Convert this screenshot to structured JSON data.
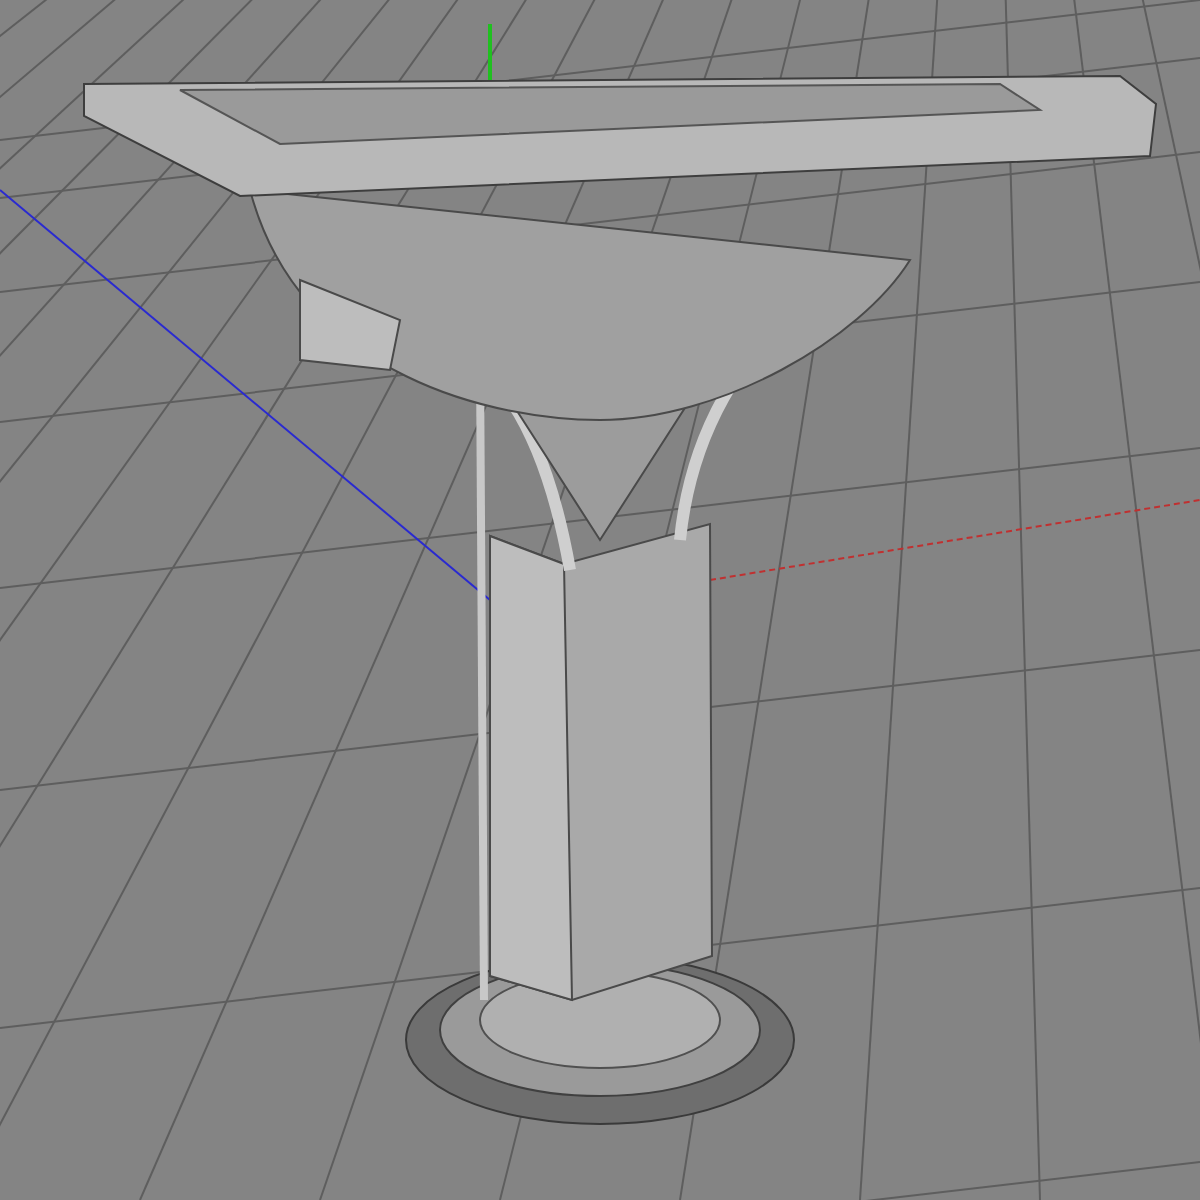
{
  "viewport": {
    "grid": true,
    "axes": true
  }
}
